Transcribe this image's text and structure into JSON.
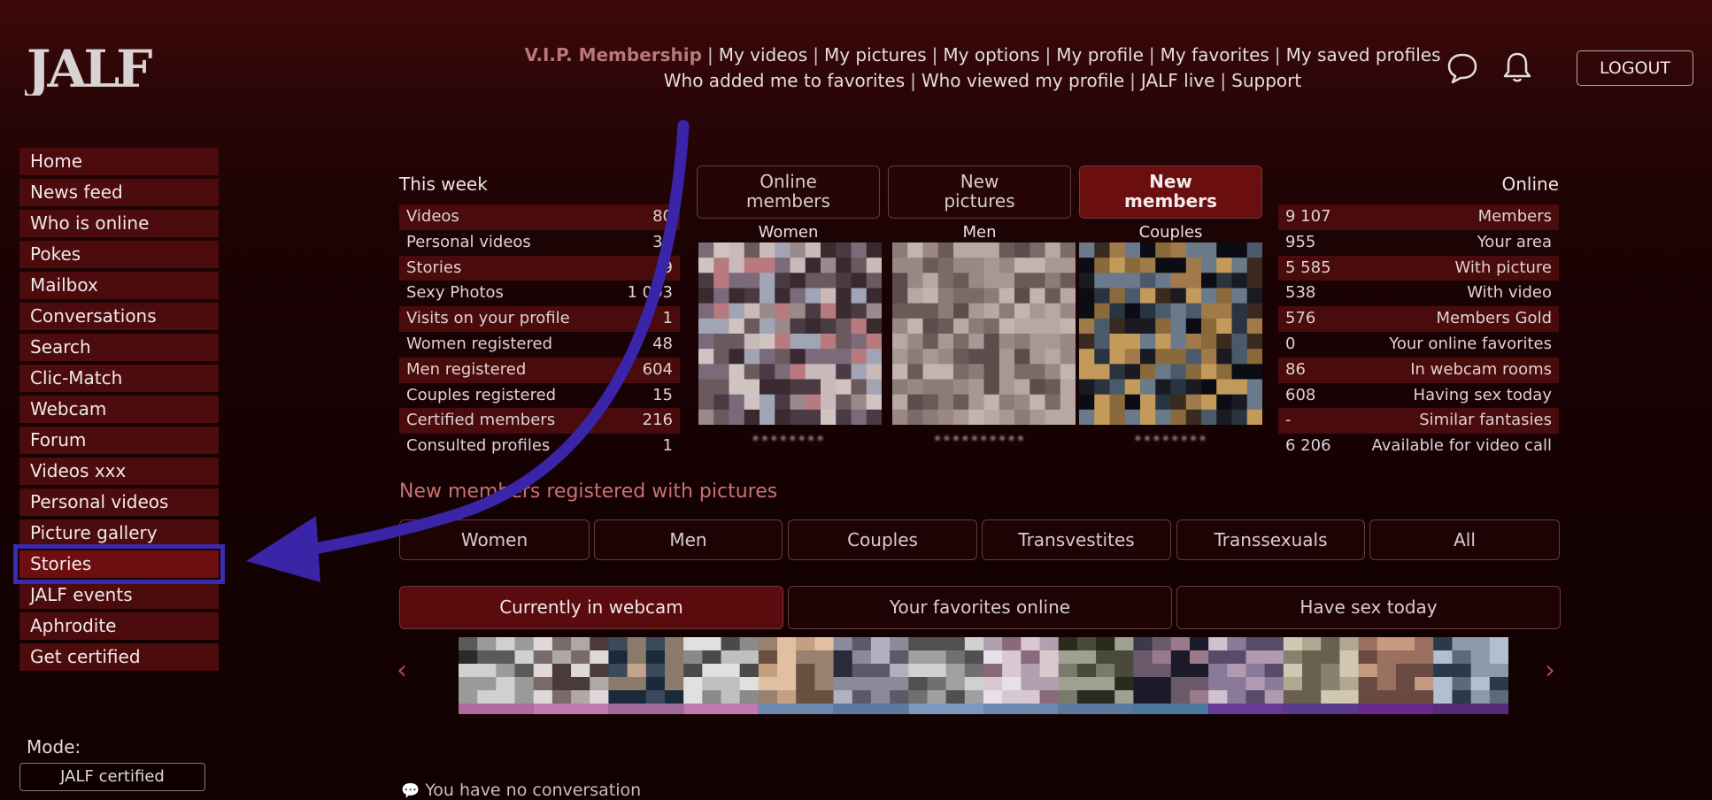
{
  "logo": {
    "text": "JALF"
  },
  "topnav": {
    "row1": [
      "V.I.P. Membership",
      "My videos",
      "My pictures",
      "My options",
      "My profile",
      "My favorites",
      "My saved profiles"
    ],
    "row2": [
      "Who added me to favorites",
      "Who viewed my profile",
      "JALF live",
      "Support"
    ]
  },
  "header": {
    "logout": "LOGOUT",
    "chat_icon": "chat-bubble-icon",
    "bell_icon": "bell-icon"
  },
  "sidebar": {
    "items": [
      "Home",
      "News feed",
      "Who is online",
      "Pokes",
      "Mailbox",
      "Conversations",
      "Search",
      "Clic-Match",
      "Webcam",
      "Forum",
      "Videos xxx",
      "Personal videos",
      "Picture gallery",
      "Stories",
      "JALF events",
      "Aphrodite",
      "Get certified"
    ],
    "active": "Stories",
    "mode_label": "Mode:",
    "mode_value": "JALF certified"
  },
  "week": {
    "title": "This week",
    "rows": [
      {
        "label": "Videos",
        "value": "80"
      },
      {
        "label": "Personal videos",
        "value": "36"
      },
      {
        "label": "Stories",
        "value": "9"
      },
      {
        "label": "Sexy Photos",
        "value": "1 003"
      },
      {
        "label": "Visits on your profile",
        "value": "1"
      },
      {
        "label": "Women registered",
        "value": "48"
      },
      {
        "label": "Men registered",
        "value": "604"
      },
      {
        "label": "Couples registered",
        "value": "15"
      },
      {
        "label": "Certified members",
        "value": "216"
      },
      {
        "label": "Consulted profiles",
        "value": "1"
      }
    ]
  },
  "online": {
    "title": "Online",
    "rows": [
      {
        "value": "9 107",
        "label": "Members"
      },
      {
        "value": "955",
        "label": "Your area"
      },
      {
        "value": "5 585",
        "label": "With picture"
      },
      {
        "value": "538",
        "label": "With video"
      },
      {
        "value": "576",
        "label": "Members Gold"
      },
      {
        "value": "0",
        "label": "Your online favorites"
      },
      {
        "value": "86",
        "label": "In webcam rooms"
      },
      {
        "value": "608",
        "label": "Having sex today"
      },
      {
        "value": "-",
        "label": "Similar fantasies"
      },
      {
        "value": "6 206",
        "label": "Available for video call"
      }
    ]
  },
  "member_buttons": [
    {
      "line1": "Online",
      "line2": "members"
    },
    {
      "line1": "New",
      "line2": "pictures"
    },
    {
      "line1": "New",
      "line2": "members"
    }
  ],
  "thumbs": [
    {
      "label": "Women",
      "name": "••••••••"
    },
    {
      "label": "Men",
      "name": "••••••••••"
    },
    {
      "label": "Couples",
      "name": "••••••••"
    }
  ],
  "new_members": {
    "title": "New members registered with pictures",
    "categories": [
      "Women",
      "Men",
      "Couples",
      "Transvestites",
      "Transsexuals",
      "All"
    ]
  },
  "tabs": [
    "Currently in webcam",
    "Your favorites online",
    "Have sex today"
  ],
  "carousel": {
    "prev": "‹",
    "next": "›"
  },
  "footer": {
    "no_conversation": "You have no conversation"
  }
}
